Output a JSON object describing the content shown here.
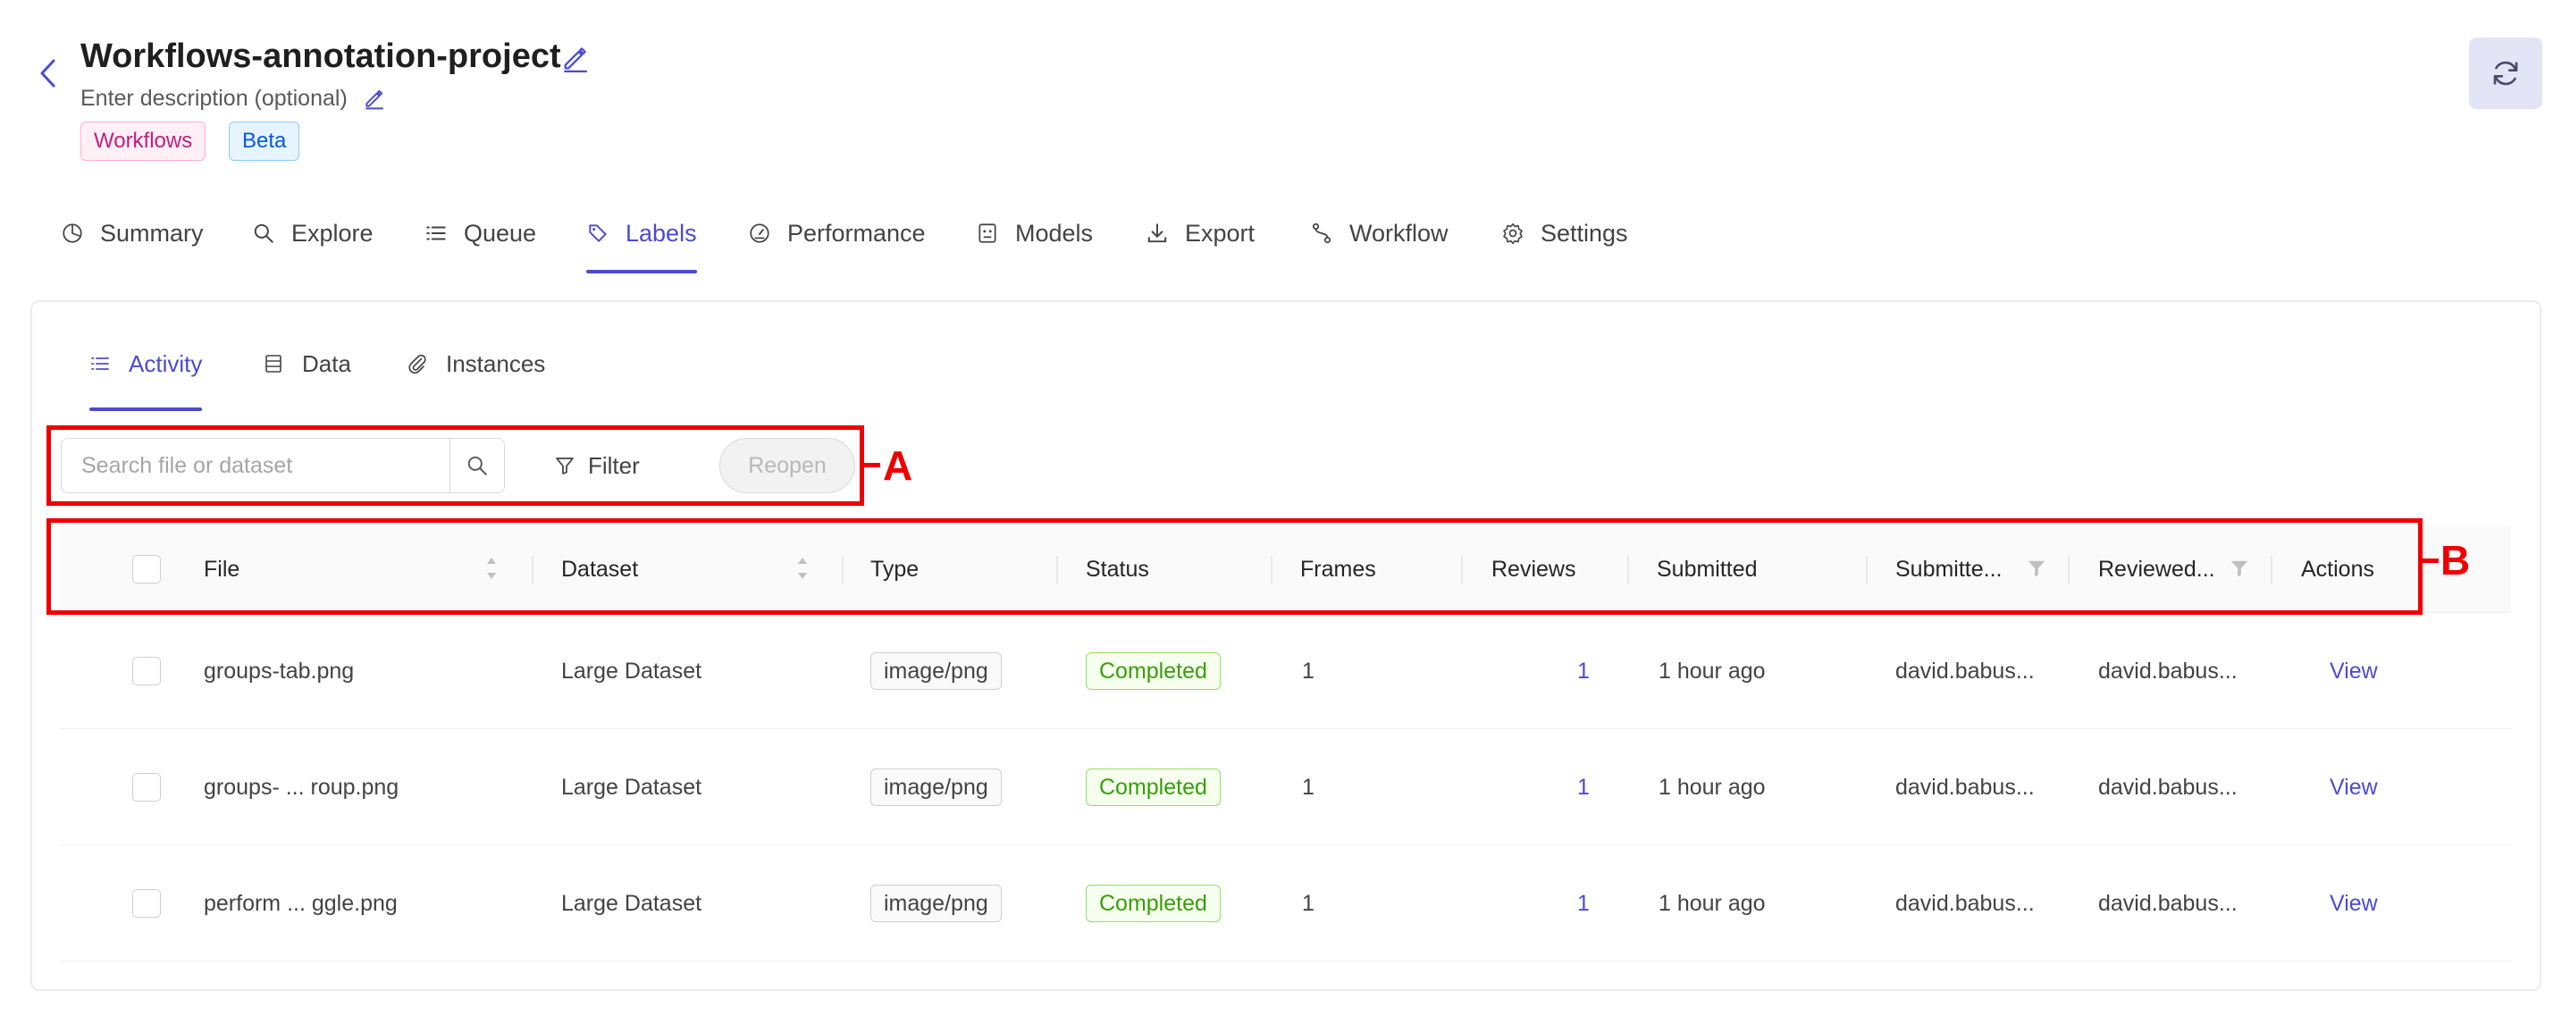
{
  "header": {
    "title": "Workflows-annotation-project",
    "description_placeholder": "Enter description (optional)",
    "tags": [
      "Workflows",
      "Beta"
    ]
  },
  "main_tabs": [
    {
      "label": "Summary",
      "icon": "pie-chart-icon"
    },
    {
      "label": "Explore",
      "icon": "search-icon"
    },
    {
      "label": "Queue",
      "icon": "list-icon"
    },
    {
      "label": "Labels",
      "icon": "tag-icon",
      "active": true
    },
    {
      "label": "Performance",
      "icon": "dashboard-icon"
    },
    {
      "label": "Models",
      "icon": "robot-icon"
    },
    {
      "label": "Export",
      "icon": "download-icon"
    },
    {
      "label": "Workflow",
      "icon": "workflow-icon"
    },
    {
      "label": "Settings",
      "icon": "gear-icon"
    }
  ],
  "sub_tabs": [
    {
      "label": "Activity",
      "icon": "list-icon",
      "active": true
    },
    {
      "label": "Data",
      "icon": "database-icon"
    },
    {
      "label": "Instances",
      "icon": "paperclip-icon"
    }
  ],
  "toolbar": {
    "search_placeholder": "Search file or dataset",
    "filter_label": "Filter",
    "reopen_label": "Reopen"
  },
  "annotations": {
    "a": "A",
    "b": "B"
  },
  "table": {
    "columns": [
      "File",
      "Dataset",
      "Type",
      "Status",
      "Frames",
      "Reviews",
      "Submitted",
      "Submitte...",
      "Reviewed...",
      "Actions"
    ],
    "rows": [
      {
        "file": "groups-tab.png",
        "dataset": "Large Dataset",
        "type": "image/png",
        "status": "Completed",
        "frames": "1",
        "reviews": "1",
        "submitted": "1 hour ago",
        "submitted_by": "david.babus...",
        "reviewed_by": "david.babus...",
        "action": "View"
      },
      {
        "file": "groups- ... roup.png",
        "dataset": "Large Dataset",
        "type": "image/png",
        "status": "Completed",
        "frames": "1",
        "reviews": "1",
        "submitted": "1 hour ago",
        "submitted_by": "david.babus...",
        "reviewed_by": "david.babus...",
        "action": "View"
      },
      {
        "file": "perform ... ggle.png",
        "dataset": "Large Dataset",
        "type": "image/png",
        "status": "Completed",
        "frames": "1",
        "reviews": "1",
        "submitted": "1 hour ago",
        "submitted_by": "david.babus...",
        "reviewed_by": "david.babus...",
        "action": "View"
      }
    ]
  },
  "colors": {
    "accent": "#4b4bd1",
    "annotation": "#ee0000",
    "status_completed": "#389e0d"
  }
}
